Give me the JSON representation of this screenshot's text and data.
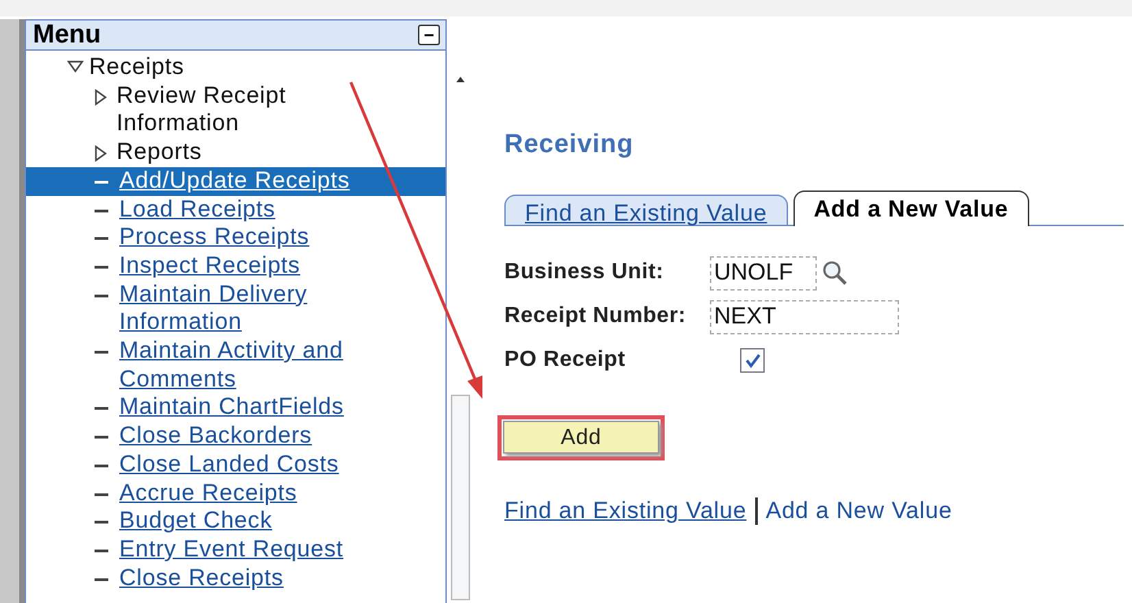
{
  "menu": {
    "title": "Menu",
    "collapse_icon": "−",
    "items": [
      {
        "label": "Receipts",
        "kind": "folder",
        "expanded": true,
        "children": [
          {
            "label": "Review Receipt Information",
            "kind": "folder",
            "expanded": false
          },
          {
            "label": "Reports",
            "kind": "folder",
            "expanded": false
          },
          {
            "label": "Add/Update Receipts",
            "kind": "link",
            "selected": true
          },
          {
            "label": "Load Receipts",
            "kind": "link",
            "selected": false
          },
          {
            "label": "Process Receipts",
            "kind": "link",
            "selected": false
          },
          {
            "label": "Inspect Receipts",
            "kind": "link",
            "selected": false
          },
          {
            "label": "Maintain Delivery Information",
            "kind": "link",
            "selected": false
          },
          {
            "label": "Maintain Activity and Comments",
            "kind": "link",
            "selected": false
          },
          {
            "label": "Maintain ChartFields",
            "kind": "link",
            "selected": false
          },
          {
            "label": "Close Backorders",
            "kind": "link",
            "selected": false
          },
          {
            "label": "Close Landed Costs",
            "kind": "link",
            "selected": false
          },
          {
            "label": "Accrue Receipts",
            "kind": "link",
            "selected": false
          },
          {
            "label": "Budget Check",
            "kind": "link",
            "selected": false
          },
          {
            "label": "Entry Event Request",
            "kind": "link",
            "selected": false
          },
          {
            "label": "Close Receipts",
            "kind": "link",
            "selected": false
          }
        ]
      }
    ]
  },
  "page": {
    "title": "Receiving",
    "tabs": [
      {
        "label": "Find an Existing Value",
        "selected": false
      },
      {
        "label": "Add a New Value",
        "selected": true
      }
    ],
    "fields": [
      {
        "label": "Business Unit:",
        "kind": "lookup",
        "value": "UNOLF"
      },
      {
        "label": "Receipt Number:",
        "kind": "text",
        "value": "NEXT"
      },
      {
        "label": "PO Receipt",
        "kind": "checkbox",
        "checked": true
      }
    ],
    "button": "Add",
    "links": [
      {
        "label": "Find an Existing Value",
        "selected": false
      },
      {
        "label": "Add a New Value",
        "selected": true
      }
    ]
  }
}
